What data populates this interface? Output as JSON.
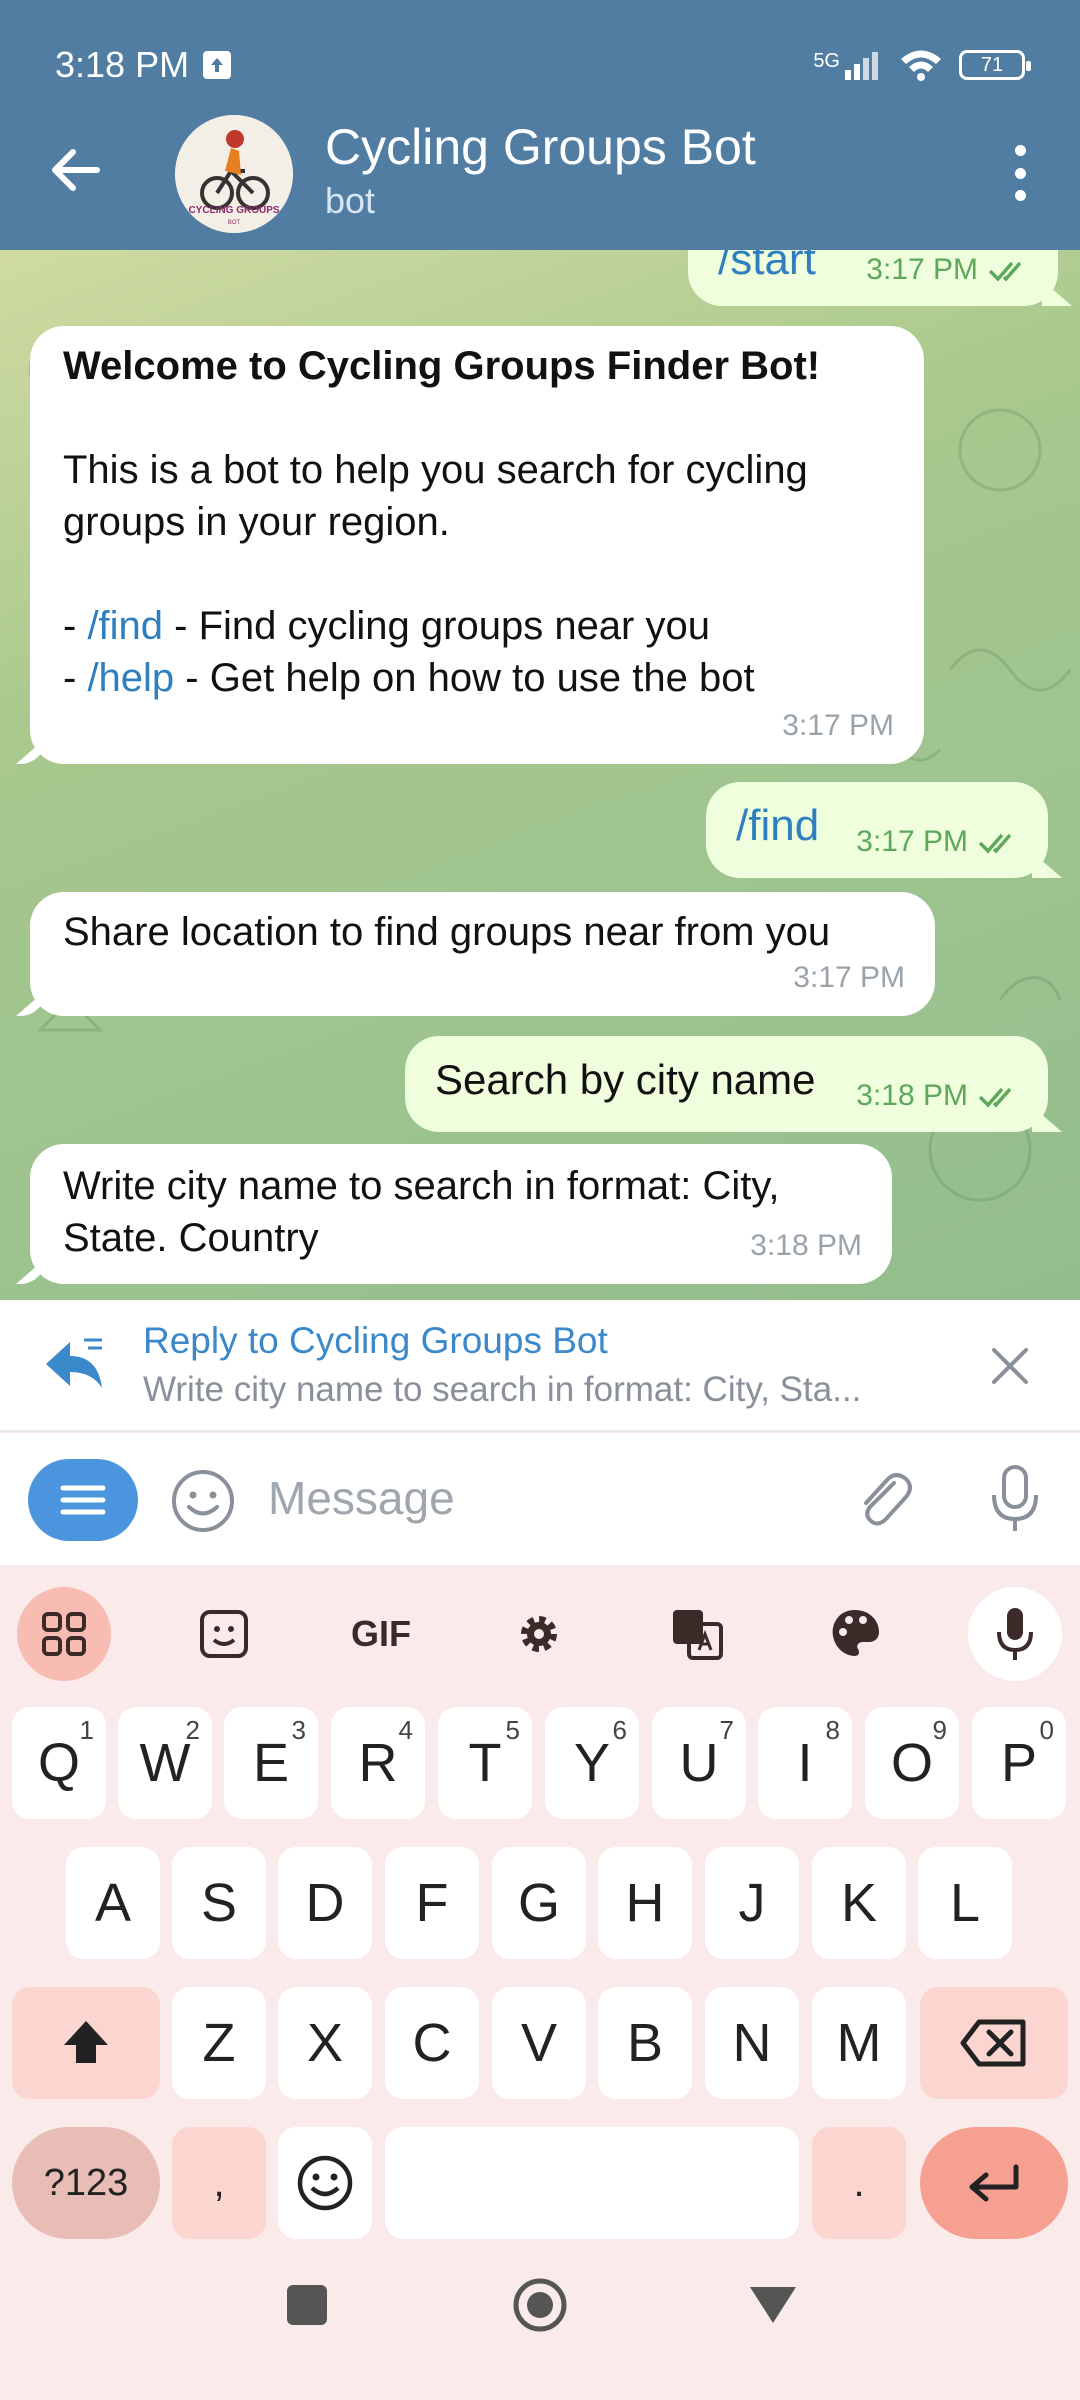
{
  "status": {
    "time": "3:18 PM",
    "network": "5G",
    "battery": "71"
  },
  "header": {
    "title": "Cycling Groups Bot",
    "subtitle": "bot",
    "avatar_text": "CYCLING GROUPS",
    "avatar_sub": "BOT"
  },
  "messages": {
    "m1": {
      "text": "/start",
      "time": "3:17 PM"
    },
    "m2": {
      "title": "Welcome to Cycling Groups Finder Bot!",
      "line1": "This is a bot to help you search for cycling",
      "line2": "groups in your region.",
      "item1_prefix": "- ",
      "item1_cmd": "/find",
      "item1_text": " - Find cycling groups near you",
      "item2_prefix": "- ",
      "item2_cmd": "/help",
      "item2_text": " - Get help on how to use the bot",
      "time": "3:17 PM"
    },
    "m3": {
      "text": "/find",
      "time": "3:17 PM"
    },
    "m4": {
      "text": "Share location to find groups near from you",
      "time": "3:17 PM"
    },
    "m5": {
      "text": "Search by city name",
      "time": "3:18 PM"
    },
    "m6": {
      "line1": "Write city name to search in format: City,",
      "line2": "State. Country",
      "time": "3:18 PM"
    }
  },
  "reply": {
    "title": "Reply to Cycling Groups Bot",
    "text": "Write city name to search in format: City, Sta..."
  },
  "input": {
    "placeholder": "Message"
  },
  "keyboard": {
    "toolbar": {
      "gif": "GIF"
    },
    "row1": [
      {
        "k": "Q",
        "n": "1"
      },
      {
        "k": "W",
        "n": "2"
      },
      {
        "k": "E",
        "n": "3"
      },
      {
        "k": "R",
        "n": "4"
      },
      {
        "k": "T",
        "n": "5"
      },
      {
        "k": "Y",
        "n": "6"
      },
      {
        "k": "U",
        "n": "7"
      },
      {
        "k": "I",
        "n": "8"
      },
      {
        "k": "O",
        "n": "9"
      },
      {
        "k": "P",
        "n": "0"
      }
    ],
    "row2": [
      "A",
      "S",
      "D",
      "F",
      "G",
      "H",
      "J",
      "K",
      "L"
    ],
    "row3": [
      "Z",
      "X",
      "C",
      "V",
      "B",
      "N",
      "M"
    ],
    "symbols": "?123",
    "comma": ",",
    "period": "."
  },
  "colors": {
    "header": "#517da2",
    "accent": "#3b88cb",
    "outgoing": "#effedd",
    "check": "#5ea85c"
  }
}
